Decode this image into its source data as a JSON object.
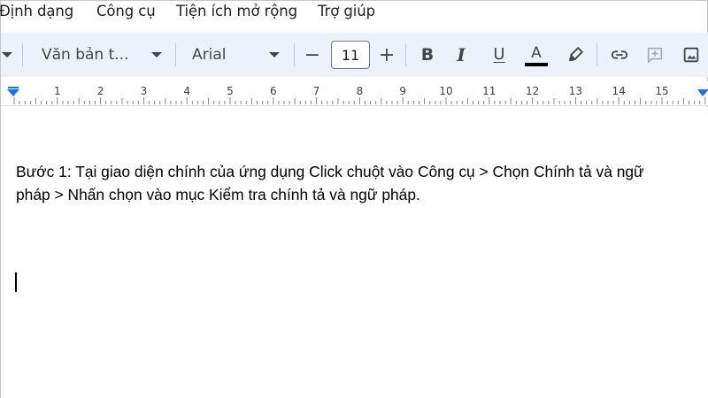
{
  "menu": {
    "items": [
      {
        "label": "Định dạng",
        "name": "menu-dinh-dang"
      },
      {
        "label": "Công cụ",
        "name": "menu-cong-cu"
      },
      {
        "label": "Tiện ích mở rộng",
        "name": "menu-tien-ich"
      },
      {
        "label": "Trợ giúp",
        "name": "menu-tro-giup"
      }
    ]
  },
  "toolbar": {
    "style_label": "Văn bản t...",
    "font_label": "Arial",
    "font_size": "11",
    "decrease_label": "−",
    "increase_label": "+",
    "bold_label": "B",
    "italic_label": "I",
    "underline_label": "U",
    "text_color_label": "A",
    "text_color": "#000000"
  },
  "ruler": {
    "numbers": [
      "1",
      "2",
      "3",
      "4",
      "5",
      "6",
      "7",
      "8",
      "9",
      "10",
      "11",
      "12",
      "13",
      "14",
      "15"
    ]
  },
  "document": {
    "line1": "Bước 1: Tại giao diện chính của ứng dụng Click chuột vào Công cụ > Chọn Chính tả và ngữ",
    "line2": "pháp > Nhấn chọn vào mục Kiểm tra chính tả và ngữ pháp."
  },
  "colors": {
    "toolbar_bg": "#edf2fa",
    "ruler_marker": "#1a73e8"
  }
}
